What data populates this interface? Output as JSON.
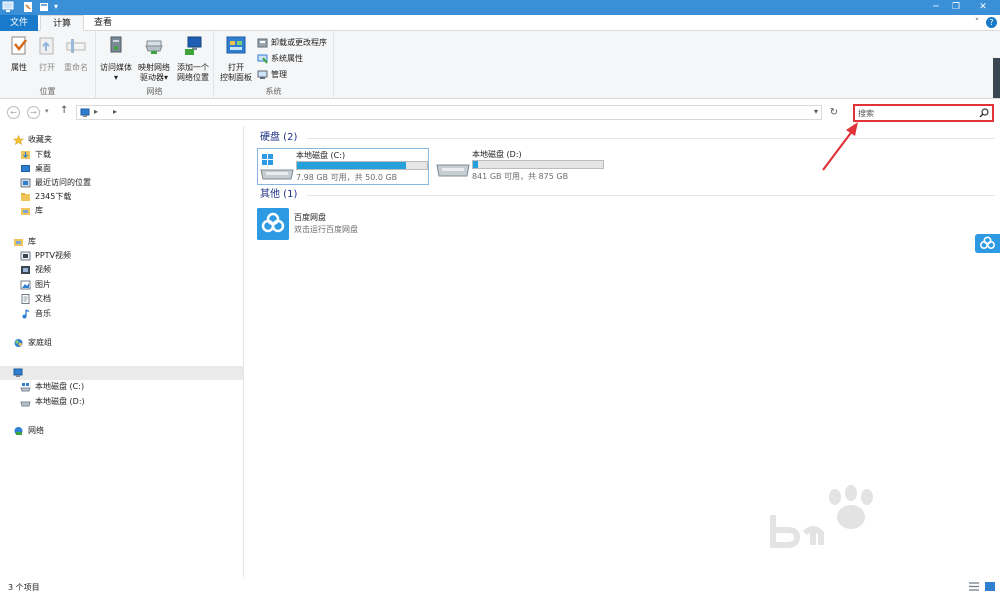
{
  "ribbon_tabs": {
    "file": "文件",
    "computer": "计算机",
    "view": "查看"
  },
  "ribbon": {
    "location_group": {
      "label": "位置",
      "properties": "属性",
      "open": "打开",
      "rename": "重命名"
    },
    "network_group": {
      "label": "网络",
      "access_media": "访问媒体",
      "map_drive_1": "映射网络",
      "map_drive_2": "驱动器",
      "add_location_1": "添加一个",
      "add_location_2": "网络位置"
    },
    "system_group": {
      "label": "系统",
      "control_panel_1": "打开",
      "control_panel_2": "控制面板",
      "uninstall": "卸载或更改程序",
      "system_properties": "系统属性",
      "manage": "管理"
    }
  },
  "search": {
    "placeholder": "搜索"
  },
  "nav": {
    "favorites": "收藏夹",
    "downloads": "下载",
    "desktop": "桌面",
    "recent": "最近访问的位置",
    "downloads2345": "2345下载",
    "library_fav": "库",
    "libraries": "库",
    "pptv": "PPTV视频",
    "videos": "视频",
    "pictures": "图片",
    "documents": "文档",
    "music": "音乐",
    "homegroup": "家庭组",
    "drive_c": "本地磁盘 (C:)",
    "drive_d": "本地磁盘 (D:)",
    "network": "网络"
  },
  "content": {
    "hdd_header": "硬盘 (2)",
    "other_header": "其他 (1)",
    "drives": [
      {
        "name": "本地磁盘 (C:)",
        "info": "7.98 GB 可用，共 50.0 GB",
        "used_fraction": 0.84
      },
      {
        "name": "本地磁盘 (D:)",
        "info": "841 GB 可用，共 875 GB",
        "used_fraction": 0.04
      }
    ],
    "app": {
      "name": "百度网盘",
      "desc": "双击运行百度网盘"
    }
  },
  "status": {
    "count": "3 个项目"
  },
  "colors": {
    "accent": "#1979ca",
    "title_bar": "#3a8fd6",
    "drive_bar": "#26a0da",
    "highlight": "#e0343a",
    "group_header": "#1e3287"
  }
}
